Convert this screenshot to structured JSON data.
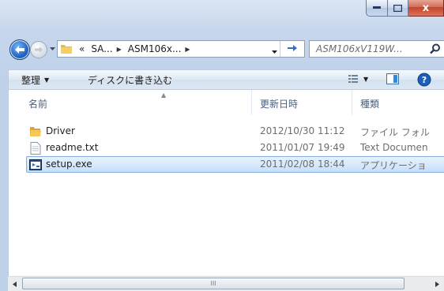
{
  "window": {
    "close_glyph": "x"
  },
  "navigation": {
    "breadcrumbs": [
      {
        "label": "«"
      },
      {
        "label": "SA..."
      },
      {
        "label": "ASM106x..."
      }
    ],
    "search_placeholder": "ASM106xV119W..."
  },
  "toolbar": {
    "organize_label": "整理",
    "burn_label": "ディスクに書き込む"
  },
  "columns": {
    "name": "名前",
    "date": "更新日時",
    "type": "種類"
  },
  "files": [
    {
      "name": "Driver",
      "date": "2012/10/30 11:12",
      "type": "ファイル フォル",
      "icon": "folder-icon"
    },
    {
      "name": "readme.txt",
      "date": "2011/01/07 19:49",
      "type": "Text Documen",
      "icon": "text-file-icon"
    },
    {
      "name": "setup.exe",
      "date": "2011/02/08 18:44",
      "type": "アプリケーショ",
      "icon": "application-icon",
      "selected": true
    }
  ],
  "scrollbar": {
    "grip": "III"
  },
  "colors": {
    "selection": "#cde6fc",
    "frame": "#c6d6ec",
    "accent": "#1f63c2"
  }
}
